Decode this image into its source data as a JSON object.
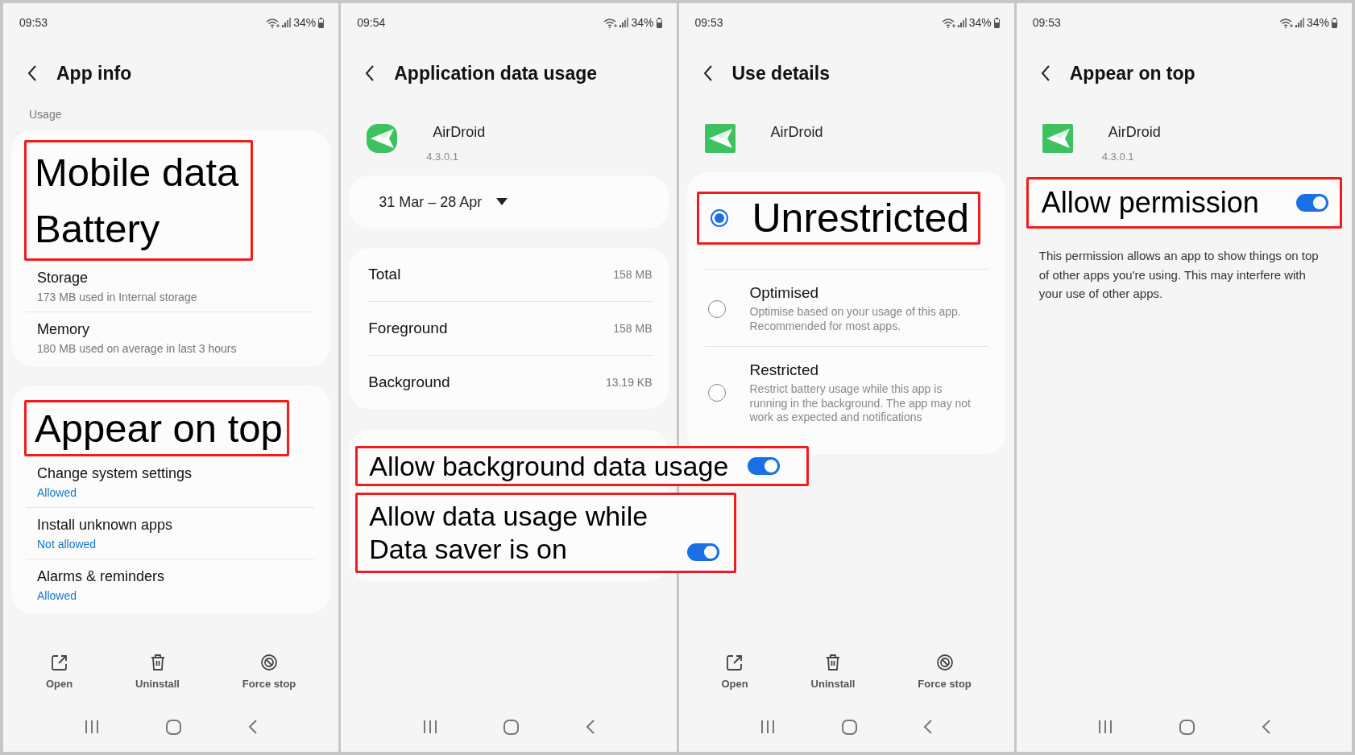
{
  "panels": [
    {
      "kind": "app_info",
      "time": "09:53",
      "battery": "34%",
      "title": "App info",
      "section": "Usage",
      "highlight_rows": [
        "Mobile data",
        "Battery"
      ],
      "rows": [
        {
          "title": "Storage",
          "detail": "173 MB used in Internal storage"
        },
        {
          "title": "Memory",
          "detail": "180 MB used on average in last 3 hours"
        }
      ],
      "highlight_title": "Appear on top",
      "permission_rows": [
        {
          "title": "Change system settings",
          "status": "Allowed"
        },
        {
          "title": "Install unknown apps",
          "status": "Not allowed"
        },
        {
          "title": "Alarms & reminders",
          "status": "Allowed"
        }
      ],
      "actions": [
        "Open",
        "Uninstall",
        "Force stop"
      ]
    },
    {
      "kind": "data_usage",
      "time": "09:54",
      "battery": "34%",
      "title": "Application data usage",
      "app": {
        "name": "AirDroid",
        "version": "4.3.0.1"
      },
      "date_range": "31 Mar – 28 Apr",
      "stats": [
        {
          "label": "Total",
          "value": "158 MB"
        },
        {
          "label": "Foreground",
          "value": "158 MB"
        },
        {
          "label": "Background",
          "value": "13.19 KB"
        }
      ],
      "toggles": [
        {
          "label": "Allow background data usage",
          "on": true
        },
        {
          "label": "Allow data usage while Data saver is on",
          "on": true
        }
      ]
    },
    {
      "kind": "use_details",
      "time": "09:53",
      "battery": "34%",
      "title": "Use details",
      "app": {
        "name": "AirDroid"
      },
      "options": [
        {
          "label": "Unrestricted",
          "selected": true,
          "highlighted": true
        },
        {
          "label": "Optimised",
          "description": "Optimise based on your usage of this app. Recommended for most apps.",
          "selected": false,
          "highlighted": false
        },
        {
          "label": "Restricted",
          "description": "Restrict battery usage while this app is running in the background. The app may not work as expected and notifications",
          "selected": false,
          "highlighted": false
        }
      ],
      "actions": [
        "Open",
        "Uninstall",
        "Force stop"
      ]
    },
    {
      "kind": "appear_on_top",
      "time": "09:53",
      "battery": "34%",
      "title": "Appear on top",
      "app": {
        "name": "AirDroid",
        "version": "4.3.0.1"
      },
      "permission": {
        "label": "Allow permission",
        "on": true
      },
      "description": "This permission allows an app to show things on top of other apps you're using. This may interfere with your use of other apps."
    }
  ]
}
